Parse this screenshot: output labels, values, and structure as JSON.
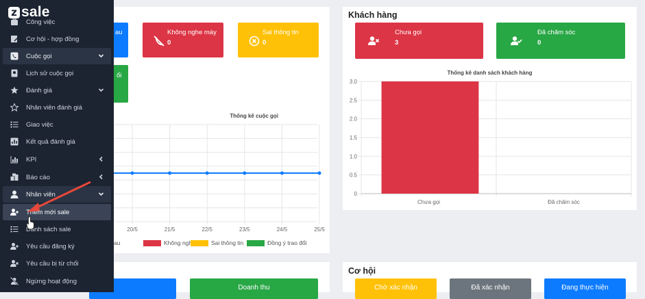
{
  "app": {
    "logo_letter": "z",
    "logo_text": "sale"
  },
  "sidebar": {
    "items": [
      {
        "label": "Công việc",
        "icon": "briefcase-icon"
      },
      {
        "label": "Cơ hội - hợp đồng",
        "icon": "contract-icon"
      },
      {
        "label": "Cuộc gọi",
        "icon": "phone-icon"
      },
      {
        "label": "Lịch sử cuộc gọi",
        "icon": "call-history-icon"
      },
      {
        "label": "Đánh giá",
        "icon": "star-group-icon"
      },
      {
        "label": "Nhân viên đánh giá",
        "icon": "star-icon"
      },
      {
        "label": "Giao việc",
        "icon": "list-icon"
      },
      {
        "label": "Kết quả đánh giá",
        "icon": "chart-square-icon"
      },
      {
        "label": "KPI",
        "icon": "bar-chart-icon"
      },
      {
        "label": "Báo cáo",
        "icon": "report-icon"
      },
      {
        "label": "Nhân viên",
        "icon": "user-icon"
      },
      {
        "label": "Thêm mới sale",
        "icon": "user-plus-icon"
      },
      {
        "label": "Danh sách sale",
        "icon": "list-icon"
      },
      {
        "label": "Yêu cầu đăng ký",
        "icon": "user-add-icon"
      },
      {
        "label": "Yêu cầu bị từ chối",
        "icon": "user-x-icon"
      },
      {
        "label": "Ngừng hoạt động",
        "icon": "user-slash-icon"
      }
    ]
  },
  "calls_panel": {
    "cards": [
      {
        "label": "au",
        "value": "",
        "color": "#0d7bff"
      },
      {
        "label": "Không nghe máy",
        "value": "0",
        "color": "#dc3545",
        "icon": "phone-slash-icon"
      },
      {
        "label": "Sai thông tin",
        "value": "0",
        "color": "#ffc107",
        "icon": "x-circle-icon"
      },
      {
        "label": "ổi",
        "value": "",
        "color": "#28a745"
      }
    ],
    "chart_title": "Thống kê cuộc gọi",
    "legend": [
      {
        "label": "au",
        "color": "#0d7bff"
      },
      {
        "label": "Không nghe máy",
        "color": "#dc3545"
      },
      {
        "label": "Sai thông tin",
        "color": "#ffc107"
      },
      {
        "label": "Đồng ý trao đổi",
        "color": "#28a745"
      }
    ]
  },
  "customers_panel": {
    "title": "Khách hàng",
    "cards": [
      {
        "label": "Chưa gọi",
        "value": "3",
        "color": "#dc3545",
        "icon": "user-x-icon"
      },
      {
        "label": "Đã chăm sóc",
        "value": "0",
        "color": "#28a745",
        "icon": "user-check-icon"
      }
    ],
    "chart_title": "Thống kê danh sách khách hàng"
  },
  "opportunities_panel": {
    "title": "Cơ hội",
    "buttons": [
      {
        "label": "Chờ xác nhận",
        "color": "#ffc107"
      },
      {
        "label": "Đã xác nhận",
        "color": "#6c757d"
      },
      {
        "label": "Đang thực hiện",
        "color": "#0d7bff"
      }
    ]
  },
  "bottom_left": {
    "buttons": [
      {
        "label": "",
        "color": "#0d7bff"
      },
      {
        "label": "Doanh thu",
        "color": "#28a745"
      }
    ]
  },
  "chart_data": [
    {
      "type": "line",
      "title": "Thống kê cuộc gọi",
      "x": [
        "20/5",
        "21/5",
        "22/5",
        "23/5",
        "24/5",
        "25/5"
      ],
      "series": [
        {
          "name": "au",
          "values": [
            0,
            0,
            0,
            0,
            0,
            0,
            0
          ],
          "color": "#0d7bff"
        }
      ],
      "grid": true,
      "legend_position": "bottom"
    },
    {
      "type": "bar",
      "title": "Thống kê danh sách khách hàng",
      "categories": [
        "Chưa gọi",
        "Đã chăm sóc"
      ],
      "values": [
        3,
        0
      ],
      "color": "#dc3545",
      "yticks": [
        "0",
        "0.5",
        "1.0",
        "1.5",
        "2.0",
        "2.5",
        "3.0"
      ],
      "ylim": [
        0,
        3
      ],
      "grid": true
    }
  ]
}
